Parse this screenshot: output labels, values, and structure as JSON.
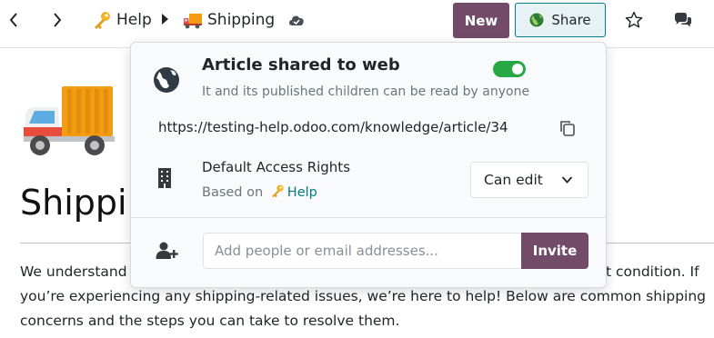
{
  "breadcrumbs": [
    {
      "icon": "key-emoji",
      "label": "Help"
    },
    {
      "icon": "truck-emoji",
      "label": "Shipping"
    }
  ],
  "toolbar": {
    "new_label": "New",
    "share_label": "Share",
    "icons": [
      "back-arrow-icon",
      "forward-arrow-icon",
      "cloud-check-icon",
      "star-icon",
      "chat-icon"
    ]
  },
  "article": {
    "cover_emoji": "delivery-truck",
    "title": "Shipping",
    "body_lines": [
      "We understand",
      "you’re experiencing any shipping-related issues, we’re here to help! Below are common shipping",
      "concerns and the steps you can take to resolve them."
    ],
    "body_right_fragment": "t condition. If"
  },
  "share_popover": {
    "title": "Article shared to web",
    "subtitle": "It and its published children can be read by anyone",
    "shared": true,
    "link": "https://testing-help.odoo.com/knowledge/article/34",
    "access": {
      "title": "Default Access Rights",
      "based_on_prefix": "Based on",
      "based_on_link": "Help",
      "selected": "Can edit"
    },
    "invite": {
      "placeholder": "Add people or email addresses...",
      "button_label": "Invite"
    }
  },
  "colors": {
    "primary": "#714b67",
    "teal": "#017e84",
    "toggle_on": "#28a745"
  }
}
